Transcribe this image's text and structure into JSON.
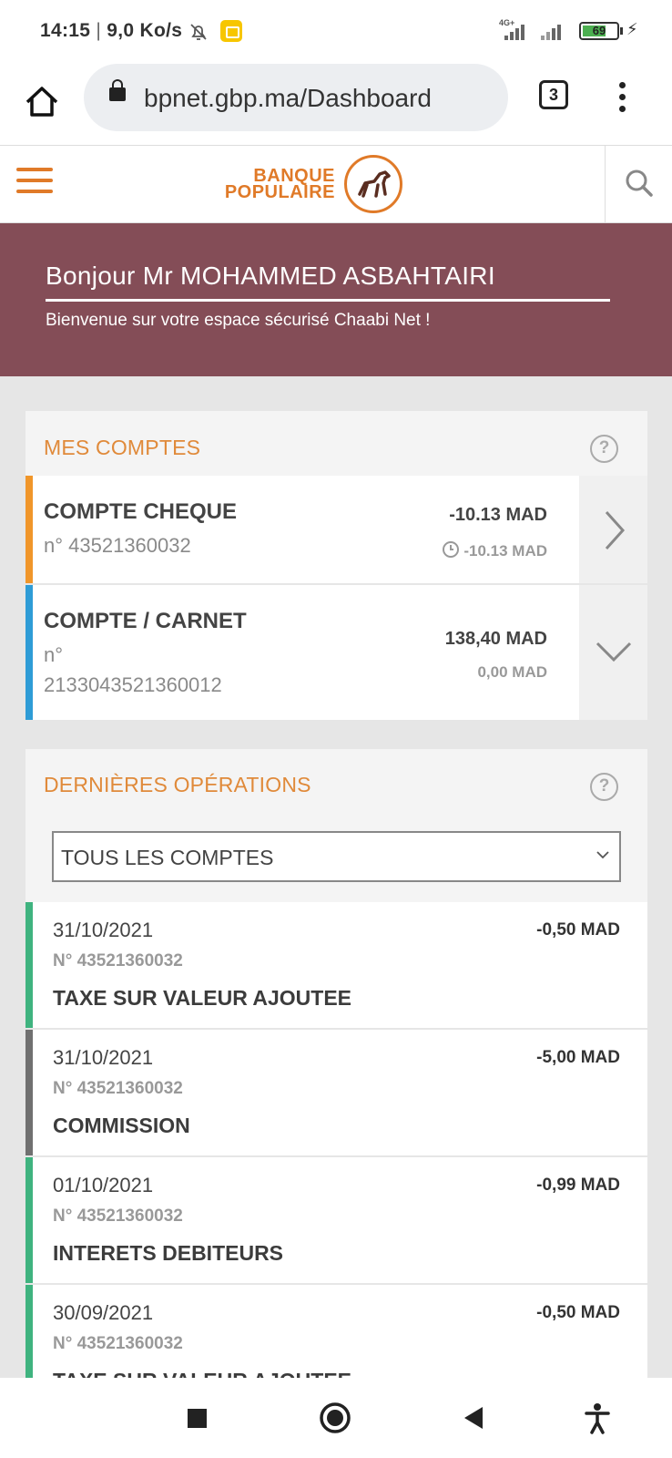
{
  "status_bar": {
    "time": "14:15",
    "speed": "9,0 Ko/s",
    "network": "4G+",
    "battery": "69"
  },
  "browser": {
    "url": "bpnet.gbp.ma/Dashboard",
    "tab_count": "3"
  },
  "site_header": {
    "logo_line1": "BANQUE",
    "logo_line2": "POPULAIRE"
  },
  "welcome": {
    "greeting": "Bonjour Mr MOHAMMED ASBAHTAIRI",
    "subtitle": "Bienvenue sur votre espace sécurisé Chaabi Net !"
  },
  "accounts_section": {
    "title": "MES COMPTES",
    "help": "?",
    "accounts": [
      {
        "name": "COMPTE CHEQUE",
        "number_line1": "n° 43521360032",
        "balance": "-10.13 MAD",
        "available": "-10.13 MAD",
        "color": "#f0962a"
      },
      {
        "name": "COMPTE / CARNET",
        "number_line1": "n°",
        "number_line2": "2133043521360012",
        "balance": "138,40 MAD",
        "available": "0,00 MAD",
        "color": "#2e9cd6"
      }
    ]
  },
  "operations_section": {
    "title": "DERNIÈRES OPÉRATIONS",
    "help": "?",
    "filter_value": "TOUS LES COMPTES",
    "operations": [
      {
        "date": "31/10/2021",
        "amount": "-0,50 MAD",
        "account": "N° 43521360032",
        "label": "TAXE SUR VALEUR AJOUTEE",
        "color": "#3fb37f"
      },
      {
        "date": "31/10/2021",
        "amount": "-5,00 MAD",
        "account": "N° 43521360032",
        "label": "COMMISSION",
        "color": "#707070"
      },
      {
        "date": "01/10/2021",
        "amount": "-0,99 MAD",
        "account": "N° 43521360032",
        "label": "INTERETS DEBITEURS",
        "color": "#3fb37f"
      },
      {
        "date": "30/09/2021",
        "amount": "-0,50 MAD",
        "account": "N° 43521360032",
        "label": "TAXE SUR VALEUR AJOUTEE",
        "color": "#3fb37f"
      }
    ]
  },
  "colors": {
    "brand_orange": "#e07a28",
    "banner": "#844d57"
  }
}
